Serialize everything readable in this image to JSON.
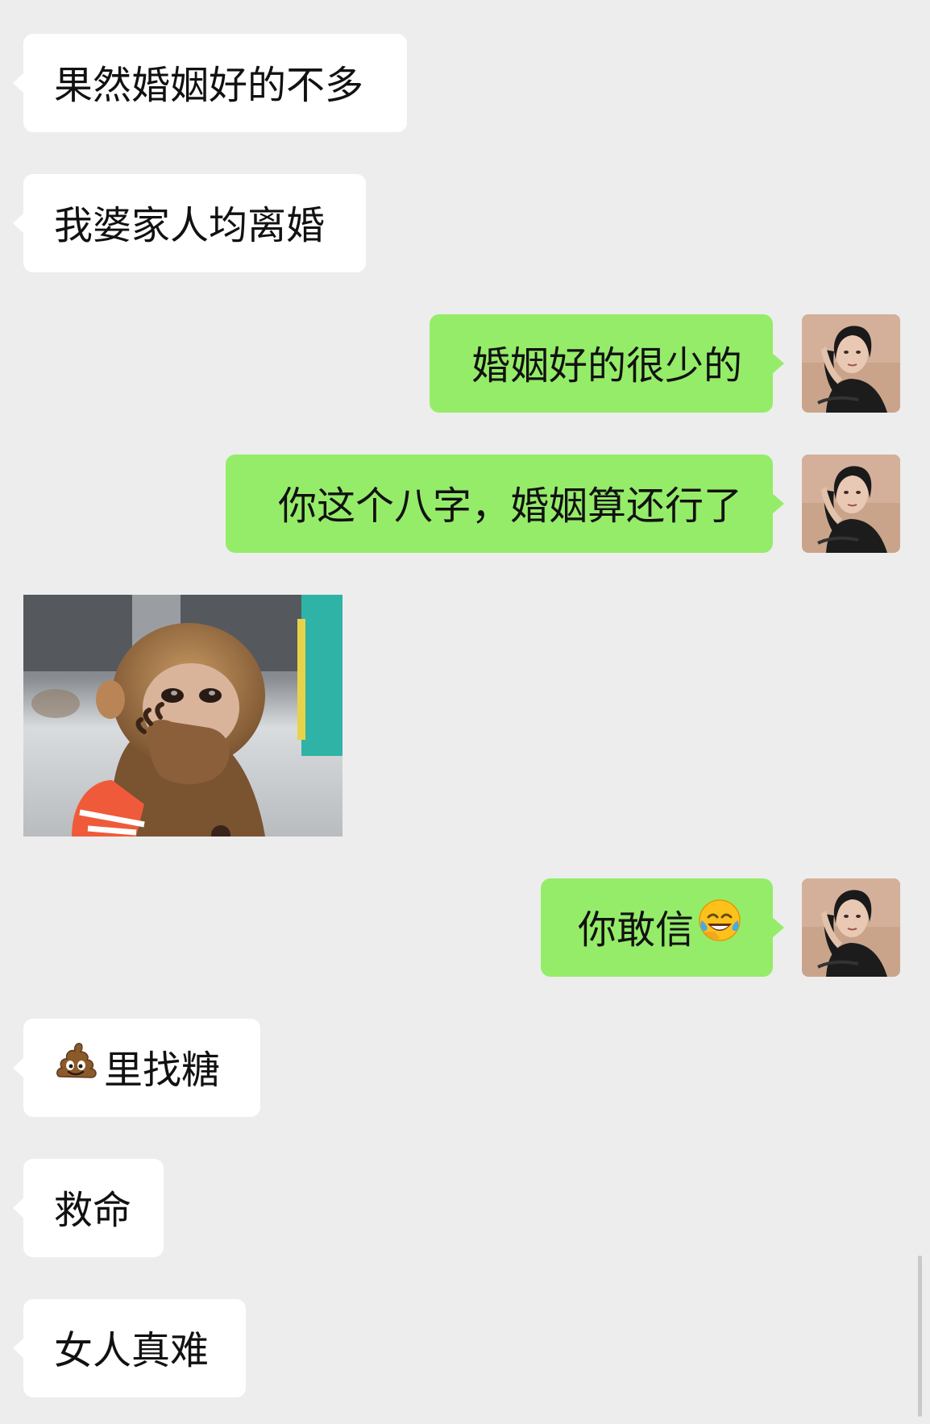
{
  "chat": {
    "messages": [
      {
        "side": "in",
        "type": "text",
        "text": "果然婚姻好的不多"
      },
      {
        "side": "in",
        "type": "text",
        "text": "我婆家人均离婚"
      },
      {
        "side": "out",
        "type": "text",
        "text": "婚姻好的很少的"
      },
      {
        "side": "out",
        "type": "text",
        "text": "你这个八字，婚姻算还行了"
      },
      {
        "side": "in",
        "type": "image",
        "description_icon": "monkey-sticker"
      },
      {
        "side": "out",
        "type": "text",
        "text": "你敢信",
        "emoji": "crying-laughing-emoji"
      },
      {
        "side": "in",
        "type": "text",
        "emoji": "poop-emoji",
        "text": "里找糖"
      },
      {
        "side": "in",
        "type": "text",
        "text": "救命"
      },
      {
        "side": "in",
        "type": "text",
        "text": "女人真难"
      }
    ]
  },
  "colors": {
    "background": "#ededed",
    "incoming_bubble": "#ffffff",
    "outgoing_bubble": "#95ec69",
    "text": "#111111"
  }
}
